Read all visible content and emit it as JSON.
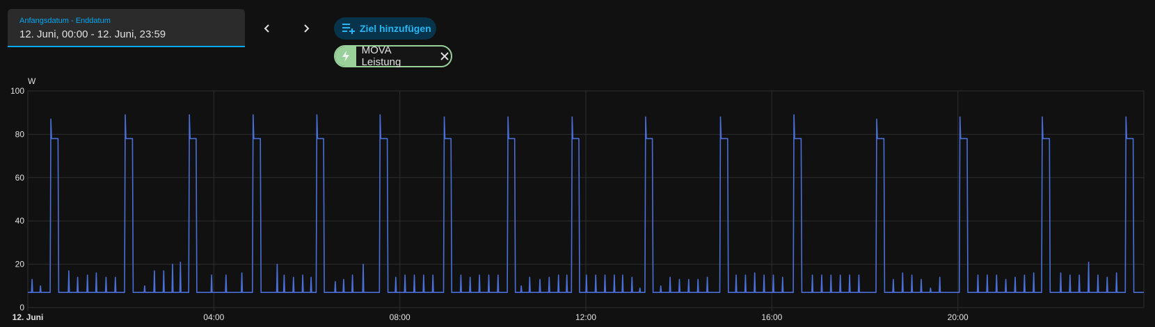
{
  "date_picker": {
    "label": "Anfangsdatum - Enddatum",
    "value": "12. Juni, 00:00 - 12. Juni, 23:59"
  },
  "nav": {
    "prev_icon": "chevron-left-icon",
    "next_icon": "chevron-right-icon"
  },
  "add_target": {
    "label": "Ziel hinzufügen",
    "icon": "playlist-plus-icon"
  },
  "entity_chip": {
    "label": "MOVA Leistung",
    "icon": "flash-icon",
    "close_icon": "close-icon",
    "color": "#9ad19b"
  },
  "colors": {
    "accent": "#03a9f4",
    "series": "#4b6fd8",
    "grid": "#2e2e2e",
    "background": "#111111"
  },
  "chart_data": {
    "type": "line",
    "unit": "W",
    "ylim": [
      0,
      100
    ],
    "y_ticks": [
      "0",
      "20",
      "40",
      "60",
      "80",
      "100"
    ],
    "y_tick_values": [
      0,
      20,
      40,
      60,
      80,
      100
    ],
    "x_range_hours": [
      0,
      24
    ],
    "x_ticks": [
      {
        "label": "12. Juni",
        "hour": 0,
        "bold": true
      },
      {
        "label": "04:00",
        "hour": 4,
        "bold": false
      },
      {
        "label": "08:00",
        "hour": 8,
        "bold": false
      },
      {
        "label": "12:00",
        "hour": 12,
        "bold": false
      },
      {
        "label": "16:00",
        "hour": 16,
        "bold": false
      },
      {
        "label": "20:00",
        "hour": 20,
        "bold": false
      }
    ],
    "grid": true,
    "series": [
      {
        "baseline_w": 7,
        "high_w": 78,
        "peaks": [
          {
            "start_h": 0.48,
            "end_h": 0.65,
            "spike": 87
          },
          {
            "start_h": 2.08,
            "end_h": 2.25,
            "spike": 89
          },
          {
            "start_h": 3.46,
            "end_h": 3.62,
            "spike": 89
          },
          {
            "start_h": 4.83,
            "end_h": 5.0,
            "spike": 89
          },
          {
            "start_h": 6.2,
            "end_h": 6.36,
            "spike": 89
          },
          {
            "start_h": 7.56,
            "end_h": 7.73,
            "spike": 89
          },
          {
            "start_h": 8.94,
            "end_h": 9.1,
            "spike": 88
          },
          {
            "start_h": 10.31,
            "end_h": 10.47,
            "spike": 88
          },
          {
            "start_h": 11.69,
            "end_h": 11.85,
            "spike": 88
          },
          {
            "start_h": 13.27,
            "end_h": 13.43,
            "spike": 88
          },
          {
            "start_h": 14.88,
            "end_h": 15.05,
            "spike": 88
          },
          {
            "start_h": 16.46,
            "end_h": 16.63,
            "spike": 89
          },
          {
            "start_h": 18.24,
            "end_h": 18.41,
            "spike": 87
          },
          {
            "start_h": 20.03,
            "end_h": 20.2,
            "spike": 88
          },
          {
            "start_h": 21.8,
            "end_h": 21.97,
            "spike": 88
          },
          {
            "start_h": 23.6,
            "end_h": 23.77,
            "spike": 88
          }
        ],
        "small_spikes": [
          {
            "h": 0.08,
            "w": 13
          },
          {
            "h": 0.26,
            "w": 10
          },
          {
            "h": 0.87,
            "w": 17
          },
          {
            "h": 1.06,
            "w": 14
          },
          {
            "h": 1.27,
            "w": 15
          },
          {
            "h": 1.46,
            "w": 16
          },
          {
            "h": 1.67,
            "w": 14
          },
          {
            "h": 1.87,
            "w": 14
          },
          {
            "h": 2.5,
            "w": 10
          },
          {
            "h": 2.71,
            "w": 17
          },
          {
            "h": 2.91,
            "w": 17
          },
          {
            "h": 3.1,
            "w": 20
          },
          {
            "h": 3.27,
            "w": 21
          },
          {
            "h": 3.94,
            "w": 15
          },
          {
            "h": 4.25,
            "w": 15
          },
          {
            "h": 4.59,
            "w": 16
          },
          {
            "h": 5.35,
            "w": 20
          },
          {
            "h": 5.5,
            "w": 15
          },
          {
            "h": 5.7,
            "w": 14
          },
          {
            "h": 5.9,
            "w": 15
          },
          {
            "h": 6.08,
            "w": 14
          },
          {
            "h": 6.6,
            "w": 12
          },
          {
            "h": 6.78,
            "w": 13
          },
          {
            "h": 6.97,
            "w": 15
          },
          {
            "h": 7.2,
            "w": 20
          },
          {
            "h": 7.9,
            "w": 14
          },
          {
            "h": 8.1,
            "w": 15
          },
          {
            "h": 8.3,
            "w": 15
          },
          {
            "h": 8.5,
            "w": 15
          },
          {
            "h": 8.7,
            "w": 15
          },
          {
            "h": 9.3,
            "w": 15
          },
          {
            "h": 9.5,
            "w": 14
          },
          {
            "h": 9.7,
            "w": 15
          },
          {
            "h": 9.9,
            "w": 15
          },
          {
            "h": 10.1,
            "w": 15
          },
          {
            "h": 10.6,
            "w": 10
          },
          {
            "h": 10.78,
            "w": 14
          },
          {
            "h": 11.0,
            "w": 13
          },
          {
            "h": 11.2,
            "w": 14
          },
          {
            "h": 11.4,
            "w": 15
          },
          {
            "h": 11.58,
            "w": 15
          },
          {
            "h": 12.0,
            "w": 15
          },
          {
            "h": 12.2,
            "w": 15
          },
          {
            "h": 12.4,
            "w": 15
          },
          {
            "h": 12.6,
            "w": 15
          },
          {
            "h": 12.78,
            "w": 15
          },
          {
            "h": 12.98,
            "w": 14
          },
          {
            "h": 13.15,
            "w": 9
          },
          {
            "h": 13.6,
            "w": 10
          },
          {
            "h": 13.8,
            "w": 14
          },
          {
            "h": 14.0,
            "w": 13
          },
          {
            "h": 14.2,
            "w": 13
          },
          {
            "h": 14.4,
            "w": 13
          },
          {
            "h": 14.6,
            "w": 14
          },
          {
            "h": 15.22,
            "w": 15
          },
          {
            "h": 15.42,
            "w": 15
          },
          {
            "h": 15.62,
            "w": 16
          },
          {
            "h": 15.82,
            "w": 15
          },
          {
            "h": 16.02,
            "w": 15
          },
          {
            "h": 16.22,
            "w": 14
          },
          {
            "h": 16.86,
            "w": 15
          },
          {
            "h": 17.06,
            "w": 15
          },
          {
            "h": 17.26,
            "w": 15
          },
          {
            "h": 17.46,
            "w": 15
          },
          {
            "h": 17.66,
            "w": 15
          },
          {
            "h": 17.86,
            "w": 15
          },
          {
            "h": 18.6,
            "w": 13
          },
          {
            "h": 18.8,
            "w": 16
          },
          {
            "h": 19.0,
            "w": 15
          },
          {
            "h": 19.2,
            "w": 13
          },
          {
            "h": 19.4,
            "w": 9
          },
          {
            "h": 19.6,
            "w": 14
          },
          {
            "h": 20.42,
            "w": 15
          },
          {
            "h": 20.62,
            "w": 15
          },
          {
            "h": 20.82,
            "w": 15
          },
          {
            "h": 21.02,
            "w": 13
          },
          {
            "h": 21.22,
            "w": 14
          },
          {
            "h": 21.42,
            "w": 15
          },
          {
            "h": 21.62,
            "w": 16
          },
          {
            "h": 22.2,
            "w": 16
          },
          {
            "h": 22.4,
            "w": 15
          },
          {
            "h": 22.6,
            "w": 15
          },
          {
            "h": 22.8,
            "w": 21
          },
          {
            "h": 23.0,
            "w": 15
          },
          {
            "h": 23.2,
            "w": 14
          },
          {
            "h": 23.4,
            "w": 16
          }
        ]
      }
    ]
  }
}
